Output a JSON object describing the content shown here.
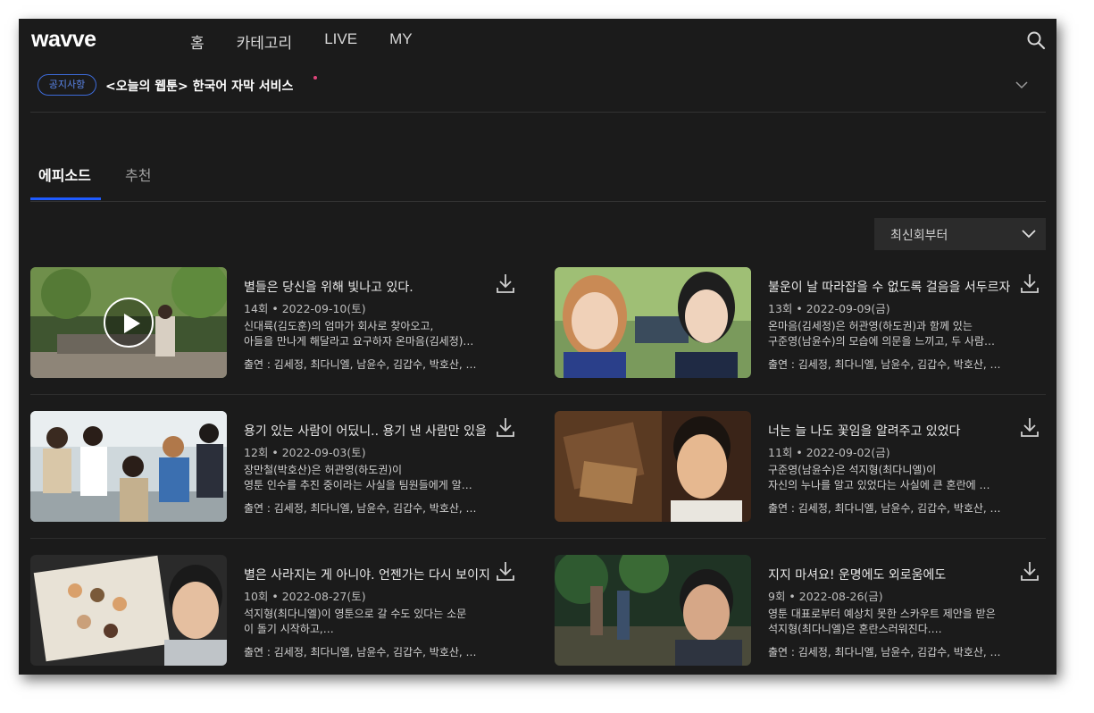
{
  "header": {
    "logo": "wavve",
    "nav": [
      "홈",
      "카테고리",
      "LIVE",
      "MY"
    ]
  },
  "notice": {
    "badge": "공지사항",
    "text": "<오늘의 웹툰> 한국어 자막 서비스"
  },
  "tabs": [
    "에피소드",
    "추천"
  ],
  "sort": {
    "label": "최신회부터"
  },
  "episodes": [
    {
      "title": "별들은 당신을 위해 빛나고 있다.",
      "meta": "14회 • 2022-09-10(토)",
      "desc1": "신대륙(김도훈)의 엄마가 회사로 찾아오고,",
      "desc2": "아들을 만나게 해달라고 요구하자 온마음(김세정)…",
      "cast": "출연 : 김세정, 최다니엘, 남윤수, 김갑수, 박호산, …"
    },
    {
      "title": "불운이 날 따라잡을 수 없도록 걸음을 서두르자",
      "meta": "13회 • 2022-09-09(금)",
      "desc1": "온마음(김세정)은 허관영(하도권)과 함께 있는",
      "desc2": "구준영(남윤수)의 모습에 의문을 느끼고, 두 사람…",
      "cast": "출연 : 김세정, 최다니엘, 남윤수, 김갑수, 박호산, …"
    },
    {
      "title": "용기 있는 사람이 어딨니.. 용기 낸 사람만 있을 뿐",
      "meta": "12회 • 2022-09-03(토)",
      "desc1": "장만철(박호산)은 허관영(하도권)이",
      "desc2": "영툰 인수를 추진 중이라는 사실을 팀원들에게 알…",
      "cast": "출연 : 김세정, 최다니엘, 남윤수, 김갑수, 박호산, …"
    },
    {
      "title": "너는 늘 나도 꽃임을 알려주고 있었다",
      "meta": "11회 • 2022-09-02(금)",
      "desc1": "구준영(남윤수)은 석지형(최다니엘)이",
      "desc2": "자신의 누나를 알고 있었다는 사실에 큰 혼란에 …",
      "cast": "출연 : 김세정, 최다니엘, 남윤수, 김갑수, 박호산, …"
    },
    {
      "title": "별은 사라지는 게 아니야. 언젠가는 다시 보이지",
      "meta": "10회 • 2022-08-27(토)",
      "desc1": "석지형(최다니엘)이 영툰으로 갈 수도 있다는 소문",
      "desc2": "이 돌기 시작하고,…",
      "cast": "출연 : 김세정, 최다니엘, 남윤수, 김갑수, 박호산, …"
    },
    {
      "title": "지지 마셔요! 운명에도 외로움에도",
      "meta": "9회 • 2022-08-26(금)",
      "desc1": "영툰 대표로부터 예상치 못한 스카우트 제안을 받은",
      "desc2": "석지형(최다니엘)은 혼란스러워진다.…",
      "cast": "출연 : 김세정, 최다니엘, 남윤수, 김갑수, 박호산, …"
    }
  ],
  "colors": {
    "background": "#1b1b1b",
    "accent": "#1f5bff",
    "notice_badge": "#3d6bd9",
    "notice_dot": "#e0457b"
  }
}
